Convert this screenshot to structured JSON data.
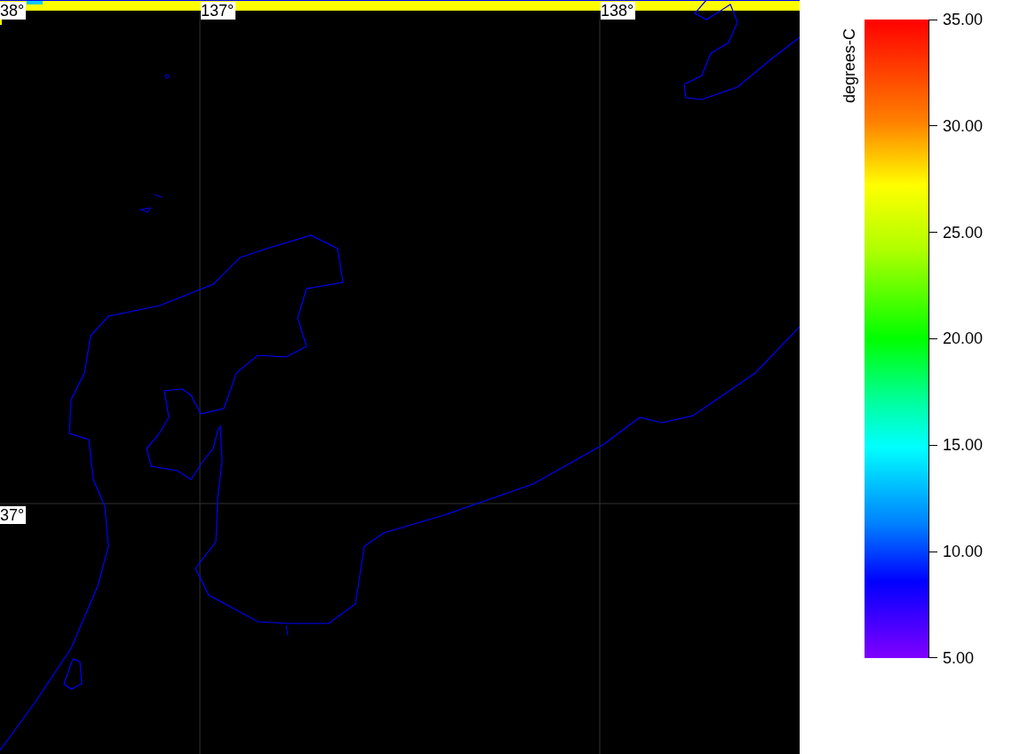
{
  "map": {
    "lat_labels": [
      "38°",
      "37°"
    ],
    "lon_labels": [
      "137°",
      "138°"
    ]
  },
  "colorbar": {
    "title": "degrees-C",
    "ticks": [
      "35.00",
      "30.00",
      "25.00",
      "20.00",
      "15.00",
      "10.00",
      "5.00"
    ]
  }
}
